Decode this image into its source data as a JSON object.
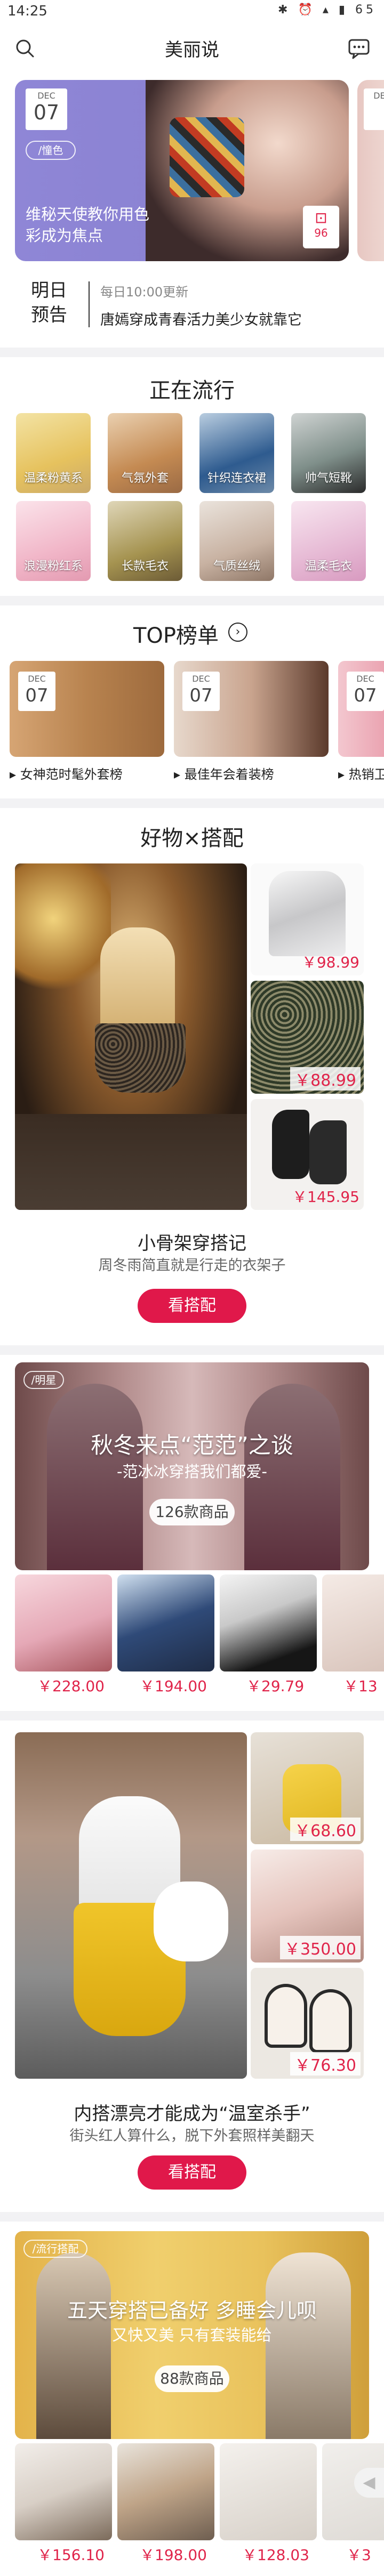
{
  "status": {
    "time": "14:25",
    "battery": "65"
  },
  "header": {
    "title": "美丽说"
  },
  "hero": {
    "month": "DEC",
    "day": "07",
    "tag": "/憧色",
    "headline": "维秘天使教你用色彩成为焦点",
    "likes": "96"
  },
  "preview": {
    "label_line1": "明日",
    "label_line2": "预告",
    "update_time": "每日10:00更新",
    "text": "唐嫣穿成青春活力美少女就靠它"
  },
  "trending": {
    "title": "正在流行",
    "items": [
      {
        "label": "温柔粉黄系"
      },
      {
        "label": "气氛外套"
      },
      {
        "label": "针织连衣裙"
      },
      {
        "label": "帅气短靴"
      },
      {
        "label": "浪漫粉红系"
      },
      {
        "label": "长款毛衣"
      },
      {
        "label": "气质丝绒"
      },
      {
        "label": "温柔毛衣"
      }
    ]
  },
  "top": {
    "title": "TOP榜单",
    "cards": [
      {
        "month": "DEC",
        "day": "07",
        "caption": "女神范时髦外套榜"
      },
      {
        "month": "DEC",
        "day": "07",
        "caption": "最佳年会着装榜"
      },
      {
        "month": "DEC",
        "day": "07",
        "caption": "热销卫衣"
      }
    ]
  },
  "outfit1": {
    "section_title": "好物×搭配",
    "prices": [
      "￥98.99",
      "￥88.99",
      "￥145.95"
    ],
    "title": "小骨架穿搭记",
    "subtitle": "周冬雨简直就是行走的衣架子",
    "button": "看搭配"
  },
  "celeb": {
    "tag": "/明星",
    "headline": "秋冬来点“范范”之谈",
    "subline": "-范冰冰穿搭我们都爱-",
    "count": "126款商品",
    "prices": [
      "￥228.00",
      "￥194.00",
      "￥29.79",
      "￥13"
    ]
  },
  "outfit2": {
    "prices": [
      "￥68.60",
      "￥350.00",
      "￥76.30"
    ],
    "title": "内搭漂亮才能成为“温室杀手”",
    "subtitle": "街头红人算什么，脱下外套照样美翻天",
    "button": "看搭配"
  },
  "weekly": {
    "tag": "/流行搭配",
    "headline": "五天穿搭已备好 多睡会儿呗",
    "subline": "又快又美 只有套装能给",
    "count": "88款商品",
    "prices": [
      "￥156.10",
      "￥198.00",
      "￥128.03",
      "￥3"
    ]
  }
}
